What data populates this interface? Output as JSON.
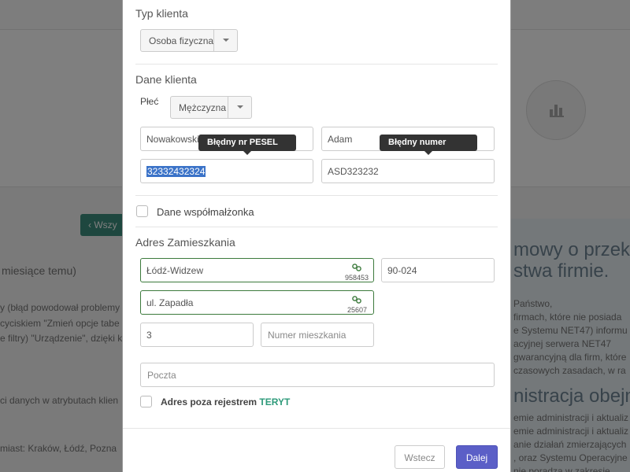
{
  "background": {
    "back_button": "‹ Wszy",
    "left_texts": [
      "miesiące temu)",
      "y (błąd powodował problemy",
      "cyciskiem \"Zmień opcje tabe",
      "e filtry) \"Urządzenie\", dzięki k",
      "ci danych w atrybutach klien",
      "miast: Kraków, Łódź, Pozna"
    ],
    "right_heading_1": "mowy o przekaz",
    "right_heading_2": "stwa firmie.",
    "right_texts": [
      "Państwo,",
      "firmach, które nie posiada",
      "e Systemu NET47) informu",
      "acyjnej serwera NET47",
      "gwarancyjną dla firm, które",
      "czasowych zasadach, w ra"
    ],
    "right_heading_3": "nistracja obejm",
    "right_texts_2": [
      "emie administracji i aktualiz",
      "emie administracji i aktualiz",
      "anie działań zmierzających",
      ", oraz Systemu Operacyjne",
      "nie poradzą w zakresie"
    ]
  },
  "modal": {
    "client_type": {
      "title": "Typ klienta",
      "selected": "Osoba fizyczna"
    },
    "client_data": {
      "title": "Dane klienta",
      "gender_label": "Płeć",
      "gender_selected": "Mężczyzna",
      "last_name": "Nowakowski",
      "first_name": "Adam",
      "pesel": "32332432324",
      "id_number": "ASD323232",
      "pesel_error": "Błędny nr PESEL",
      "number_error": "Błędny numer"
    },
    "spouse": {
      "label": "Dane współmałżonka"
    },
    "address": {
      "title": "Adres Zamieszkania",
      "city": "Łódź-Widzew",
      "city_code": "958453",
      "postal_code": "90-024",
      "street": "ul. Zapadła",
      "street_code": "25607",
      "house_number": "3",
      "flat_placeholder": "Numer mieszkania",
      "post_placeholder": "Poczta",
      "outside_register_label": "Adres poza rejestrem",
      "teryt_label": "TERYT"
    },
    "footer": {
      "back_label": "Wstecz",
      "next_label": "Dalej"
    }
  },
  "colors": {
    "accent": "#5b5fc7",
    "teryt_border": "#3c7a3c",
    "teryt_text": "#2e9a7a",
    "tooltip": "#333333"
  }
}
